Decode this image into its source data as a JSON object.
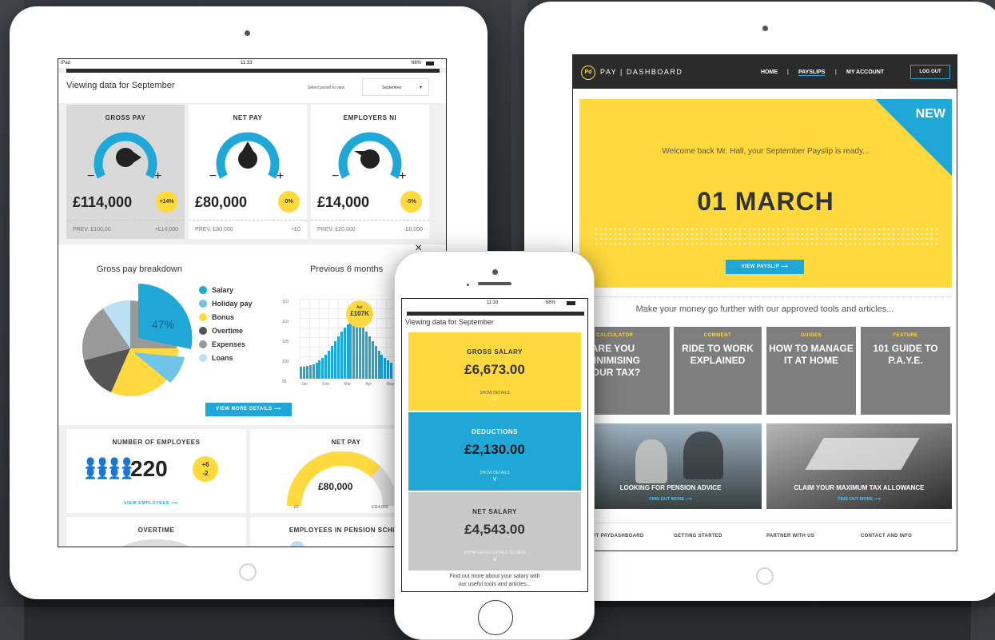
{
  "tablet_left": {
    "status": {
      "device": "iPad",
      "time": "11:33",
      "battery": "68%"
    },
    "header": {
      "title": "Viewing data for September",
      "period_label": "Select period to view",
      "period_value": "September"
    },
    "gauges": [
      {
        "title": "GROSS PAY",
        "value": "£114,000",
        "change": "+14%",
        "prev_label": "PREV. £100,00",
        "prev_diff": "+£14,000"
      },
      {
        "title": "NET PAY",
        "value": "£80,000",
        "change": "0%",
        "prev_label": "PREV. £80,000",
        "prev_diff": "+£0"
      },
      {
        "title": "EMPLOYERS NI",
        "value": "£14,000",
        "change": "-5%",
        "prev_label": "PREV. £20,000",
        "prev_diff": "-£6,000"
      }
    ],
    "breakdown": {
      "title": "Gross pay breakdown",
      "salary_pct": "47%",
      "legend": [
        {
          "label": "Salary",
          "color": "#1fa7d8"
        },
        {
          "label": "Holiday pay",
          "color": "#6ec5e9"
        },
        {
          "label": "Bonus",
          "color": "#ffd93d"
        },
        {
          "label": "Overtime",
          "color": "#555555"
        },
        {
          "label": "Expenses",
          "color": "#999999"
        },
        {
          "label": "Loans",
          "color": "#b9e0f3"
        }
      ]
    },
    "history": {
      "title": "Previous 6 months",
      "tooltip_month": "Apr",
      "tooltip_value": "£107K",
      "months": [
        "Jan",
        "Feb",
        "Mar",
        "Apr",
        "May"
      ],
      "yticks": [
        "110",
        "110",
        "105",
        "100",
        "95"
      ]
    },
    "view_more": "VIEW MORE DETAILS",
    "employees": {
      "title": "NUMBER OF EMPLOYEES",
      "count": "220",
      "up": "+6",
      "down": "-2",
      "link": "VIEW EMPLOYEES"
    },
    "net_pay_gauge": {
      "title": "NET PAY",
      "value": "£80,000",
      "min": "£0",
      "max": "£114,000"
    },
    "overtime": {
      "title": "OVERTIME"
    },
    "pension": {
      "title": "EMPLOYEES IN PENSION SCHEM"
    }
  },
  "tablet_right": {
    "brand": "PAY | DASHBOARD",
    "nav": {
      "home": "HOME",
      "sep1": "|",
      "payslips": "PAYSLIPS",
      "sep2": "|",
      "account": "MY ACCOUNT",
      "logout": "LOG OUT"
    },
    "hero": {
      "badge": "NEW",
      "welcome": "Welcome back Mr. Hall, your September Payslip is ready...",
      "date": "01 MARCH",
      "button": "VIEW PAYSLIP"
    },
    "tools_intro": "Make your money go further with our approved tools and articles...",
    "articles": [
      {
        "category": "TAX CALCULATOR",
        "headline": "ARE YOU MINIMISING YOUR TAX?"
      },
      {
        "category": "COMMENT",
        "headline": "RIDE TO WORK EXPLAINED"
      },
      {
        "category": "GUIDES",
        "headline": "HOW TO MANAGE IT AT HOME"
      },
      {
        "category": "FEATURE",
        "headline": "101 GUIDE TO P.A.Y.E."
      }
    ],
    "photos": [
      {
        "title": "LOOKING FOR PENSION ADVICE",
        "link": "FIND OUT MORE"
      },
      {
        "title": "CLAIM YOUR MAXIMUM TAX ALLOWANCE",
        "link": "FIND OUT MORE"
      }
    ],
    "footer": [
      "UT PAYDASHBOARD",
      "GETTING STARTED",
      "PARTNER WITH US",
      "CONTACT AND INFO"
    ]
  },
  "phone": {
    "status": {
      "time": "11:33",
      "battery": "68%"
    },
    "title": "Viewing data for September",
    "cards": [
      {
        "label": "GROSS SALARY",
        "value": "£6,673.00",
        "link": "SHOW DETAILS",
        "color": "#ffd93d"
      },
      {
        "label": "DEDUCTIONS",
        "value": "£2,130.00",
        "link": "SHOW DETAILS",
        "color": "#1fa7d8"
      },
      {
        "label": "NET SALARY",
        "value": "£4,543.00",
        "link": "SHOW GROSS TOTALS TO DATE",
        "color": "#c8c8c8"
      }
    ],
    "footer_line1": "Find out more about your salary with",
    "footer_line2": "our useful tools and articles..."
  },
  "colors": {
    "accent_blue": "#1fa7d8",
    "accent_yellow": "#ffd93d",
    "tile_grey": "#7e7e7e",
    "navbar": "#2b2b2b"
  }
}
